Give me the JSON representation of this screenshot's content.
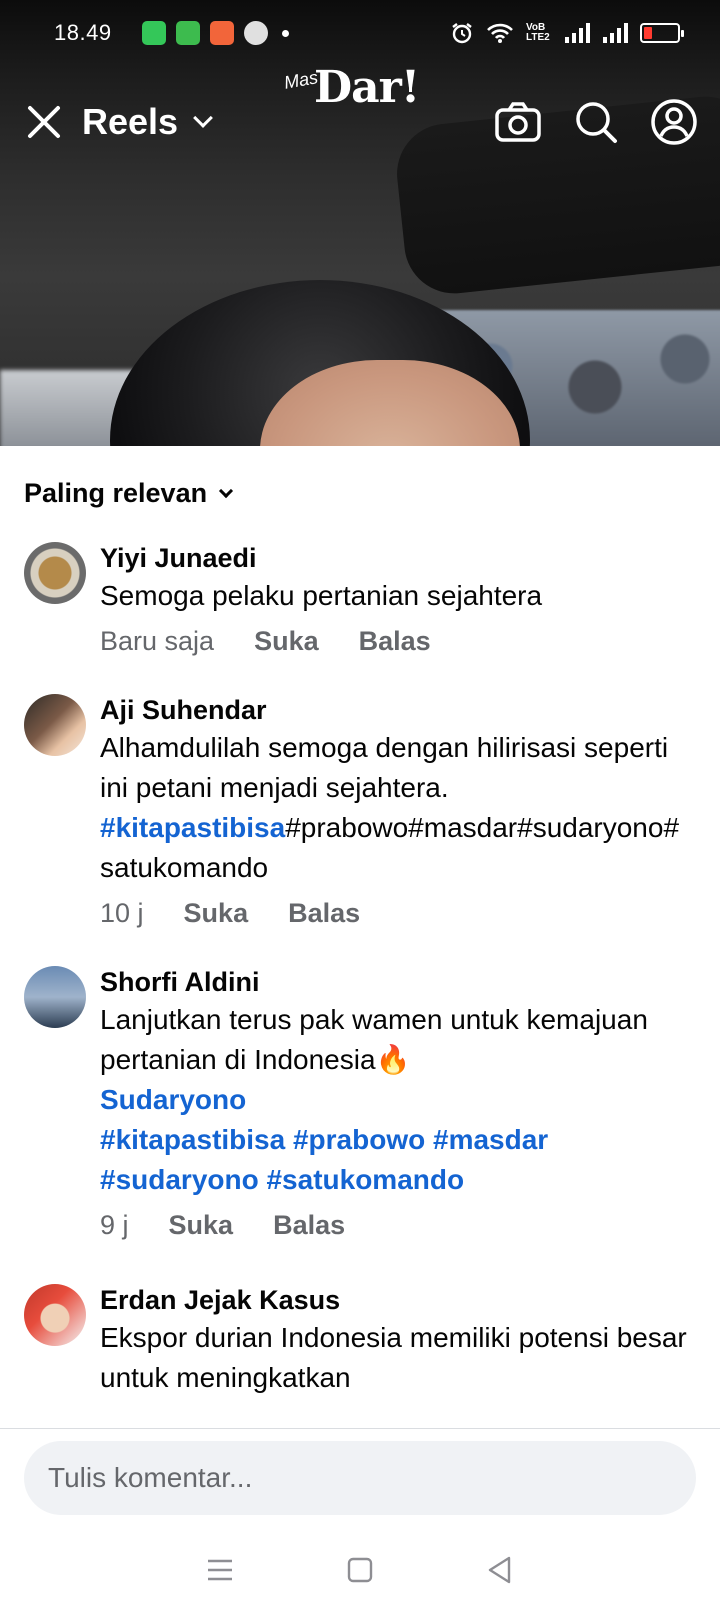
{
  "status_bar": {
    "time": "18.49",
    "network_label": "VoB LTE2"
  },
  "header": {
    "title": "Reels",
    "logo_prefix": "Mas",
    "logo_main": "Dar!"
  },
  "icons": {
    "close": "close-icon",
    "dropdown": "chevron-down-icon",
    "camera": "camera-icon",
    "search": "search-icon",
    "profile": "profile-icon"
  },
  "comments_panel": {
    "sort_label": "Paling relevan",
    "comments": [
      {
        "author": "Yiyi Junaedi",
        "text": "Semoga pelaku pertanian sejahtera",
        "time": "Baru saja",
        "like_label": "Suka",
        "reply_label": "Balas"
      },
      {
        "author": "Aji Suhendar",
        "text_plain": "Alhamdulilah semoga dengan hilirisasi seperti ini petani menjadi sejahtera. ",
        "text_tag": "#kitapastibisa",
        "text_rest": "#prabowo#masdar#sudaryono#satukomando",
        "time": "10 j",
        "like_label": "Suka",
        "reply_label": "Balas"
      },
      {
        "author": "Shorfi Aldini",
        "text_plain": "Lanjutkan terus pak wamen untuk kemajuan pertanian di Indonesia",
        "emoji": "🔥",
        "text_tags_1": "Sudaryono",
        "text_tags_2": "#kitapastibisa #prabowo #masdar",
        "text_tags_3": "#sudaryono #satukomando",
        "time": "9 j",
        "like_label": "Suka",
        "reply_label": "Balas"
      },
      {
        "author": "Erdan Jejak Kasus",
        "text": "Ekspor durian Indonesia memiliki potensi besar untuk meningkatkan"
      }
    ]
  },
  "composer": {
    "placeholder": "Tulis komentar..."
  },
  "colors": {
    "hashtag": "#1464d2",
    "meta_text": "#65676b",
    "composer_bg": "#f0f2f5"
  }
}
